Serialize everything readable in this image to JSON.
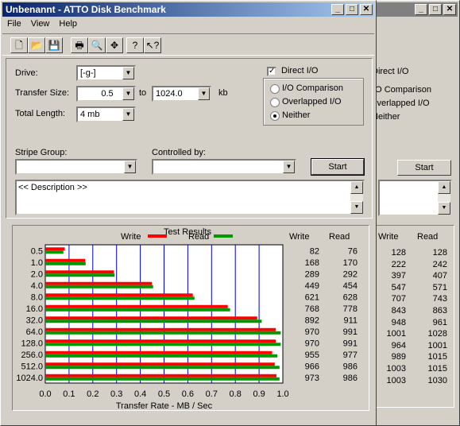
{
  "back_window": {
    "options": {
      "direct_io": "Direct I/O",
      "io_comparison": "I/O Comparison",
      "overlapped_io": "Overlapped I/O",
      "neither": "Neither"
    },
    "start_label": "Start",
    "headers": {
      "write": "Write",
      "read": "Read"
    },
    "results": [
      [
        "128",
        "128"
      ],
      [
        "222",
        "242"
      ],
      [
        "397",
        "407"
      ],
      [
        "547",
        "571"
      ],
      [
        "707",
        "743"
      ],
      [
        "843",
        "863"
      ],
      [
        "948",
        "961"
      ],
      [
        "1001",
        "1028"
      ],
      [
        "964",
        "1001"
      ],
      [
        "989",
        "1015"
      ],
      [
        "1003",
        "1015"
      ],
      [
        "1003",
        "1030"
      ]
    ]
  },
  "window": {
    "title": "Unbenannt - ATTO Disk Benchmark",
    "menu": {
      "file": "File",
      "view": "View",
      "help": "Help"
    },
    "controls": {
      "minimize": "_",
      "maximize": "□",
      "close": "✕"
    },
    "toolbar_icons": [
      "new-icon",
      "open-icon",
      "save-icon",
      "print-icon",
      "print-preview-icon",
      "move-icon",
      "help-icon",
      "context-help-icon"
    ]
  },
  "form": {
    "drive_label": "Drive:",
    "drive_value": "[-g-]",
    "transfer_size_label": "Transfer Size:",
    "transfer_from": "0.5",
    "to_label": "to",
    "transfer_to": "1024.0",
    "kb_label": "kb",
    "total_length_label": "Total Length:",
    "total_length_value": "4 mb",
    "direct_io_label": "Direct I/O",
    "io_comparison_label": "I/O Comparison",
    "overlapped_io_label": "Overlapped I/O",
    "neither_label": "Neither",
    "stripe_group_label": "Stripe Group:",
    "controlled_by_label": "Controlled by:",
    "start_label": "Start",
    "description": "<< Description >>"
  },
  "results_panel": {
    "title": "Test Results",
    "write_header": "Write",
    "read_header": "Read",
    "legend_write": "Write",
    "legend_read": "Read"
  },
  "colors": {
    "write": "#ff0000",
    "read": "#009900",
    "grid": "#0000cc"
  },
  "chart_data": {
    "type": "bar",
    "orientation": "horizontal",
    "categories": [
      "0.5",
      "1.0",
      "2.0",
      "4.0",
      "8.0",
      "16.0",
      "32.0",
      "64.0",
      "128.0",
      "256.0",
      "512.0",
      "1024.0"
    ],
    "series": [
      {
        "name": "Write",
        "values": [
          82,
          168,
          289,
          449,
          621,
          768,
          892,
          970,
          970,
          955,
          966,
          973
        ]
      },
      {
        "name": "Read",
        "values": [
          76,
          170,
          292,
          454,
          628,
          778,
          911,
          991,
          991,
          977,
          986,
          986
        ]
      }
    ],
    "xlabel": "Transfer Rate - MB / Sec",
    "xticks": [
      "0.0",
      "0.1",
      "0.2",
      "0.3",
      "0.4",
      "0.5",
      "0.6",
      "0.7",
      "0.8",
      "0.9",
      "1.0"
    ],
    "xlim": [
      0,
      1.0
    ],
    "bar_scale": "kb/sec ÷ 1000 on MB/Sec axis",
    "legend": "top"
  }
}
